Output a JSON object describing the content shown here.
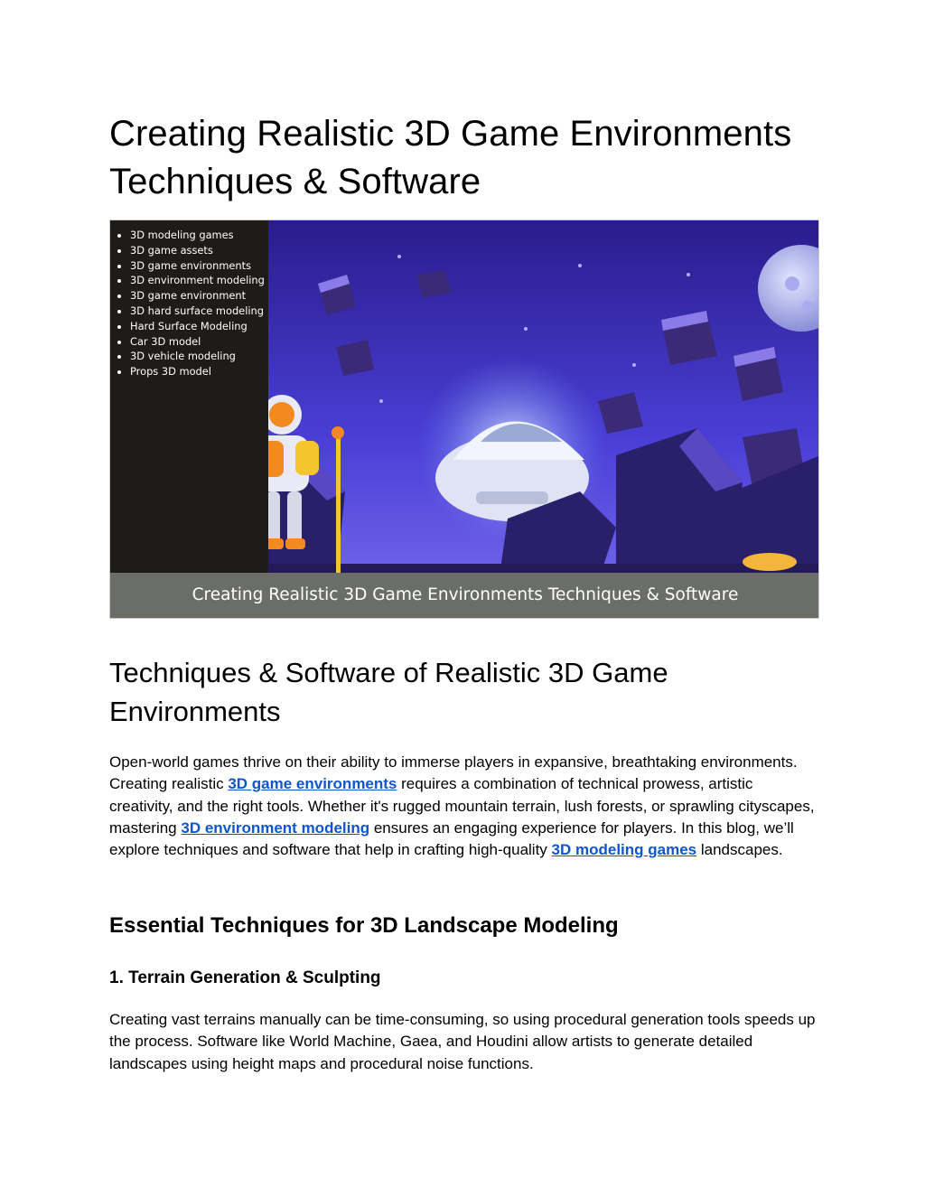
{
  "doc": {
    "title": "Creating Realistic 3D Game Environments Techniques & Software",
    "hero": {
      "tags": [
        "3D modeling games",
        "3D game assets",
        "3D game environments",
        "3D environment modeling",
        "3D game environment",
        "3D hard surface modeling",
        "Hard Surface Modeling",
        "Car 3D model",
        "3D vehicle modeling",
        "Props 3D model"
      ],
      "caption": "Creating Realistic 3D Game Environments Techniques & Software"
    },
    "section_heading": "Techniques & Software of Realistic 3D Game Environments",
    "intro": {
      "t1": "Open-world games thrive on their ability to immerse players in expansive, breathtaking environments. Creating realistic ",
      "link1": "3D game environments",
      "t2": " requires a combination of technical prowess, artistic creativity, and the right tools. Whether it's rugged mountain terrain, lush forests, or sprawling cityscapes, mastering ",
      "link2": "3D environment modeling",
      "t3": " ensures an engaging experience for players. In this blog, we’ll explore techniques and software that help in crafting high-quality ",
      "link3": "3D modeling games",
      "t4": " landscapes."
    },
    "techniques_heading": "Essential Techniques for 3D Landscape Modeling",
    "subheading_1": "1. Terrain Generation & Sculpting",
    "paragraph_1": "Creating vast terrains manually can be time-consuming, so using procedural generation tools speeds up the process. Software like World Machine, Gaea, and Houdini allow artists to generate detailed landscapes using height maps and procedural noise functions."
  }
}
